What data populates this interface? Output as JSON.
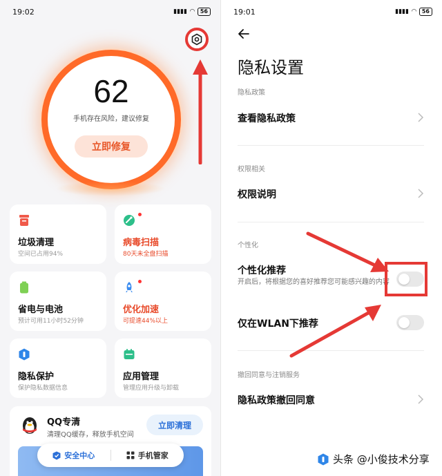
{
  "left": {
    "status_time": "19:02",
    "status_battery": "56",
    "score": "62",
    "risk_text": "手机存在风险，建议修复",
    "fix_button": "立即修复",
    "cards": [
      {
        "title": "垃圾清理",
        "subtitle": "空间已占用94%",
        "highlight": false
      },
      {
        "title": "病毒扫描",
        "subtitle": "80天未全盘扫描",
        "highlight": true
      },
      {
        "title": "省电与电池",
        "subtitle": "预计可用11小时52分钟",
        "highlight": false
      },
      {
        "title": "优化加速",
        "subtitle": "可提速44%以上",
        "highlight": true
      },
      {
        "title": "隐私保护",
        "subtitle": "保护隐私数据信息",
        "highlight": false
      },
      {
        "title": "应用管理",
        "subtitle": "管理应用升级与卸载",
        "highlight": false
      }
    ],
    "qq": {
      "title": "QQ专清",
      "subtitle": "清理QQ缓存，释放手机空间",
      "button": "立即清理"
    },
    "bottom_tabs": [
      {
        "label": "安全中心",
        "active": true
      },
      {
        "label": "手机管家",
        "active": false
      }
    ]
  },
  "right": {
    "status_time": "19:01",
    "status_battery": "56",
    "page_title": "隐私设置",
    "section_policy": "隐私政策",
    "row_view_policy": "查看隐私政策",
    "section_permissions": "权限相关",
    "row_permissions": "权限说明",
    "section_personal": "个性化",
    "row_personal": "个性化推荐",
    "row_personal_desc": "开启后，将根据您的喜好推荐您可能感兴趣的内容",
    "row_wlan": "仅在WLAN下推荐",
    "section_revoke": "撤回同意与注销服务",
    "row_revoke": "隐私政策撤回同意"
  },
  "toggles": {
    "personal_on": false,
    "wlan_on": false
  },
  "watermark": "头条 @小俊技术分享",
  "colors": {
    "accent_orange": "#ff6a28",
    "annotation_red": "#e53935",
    "blue": "#2c70d8"
  }
}
